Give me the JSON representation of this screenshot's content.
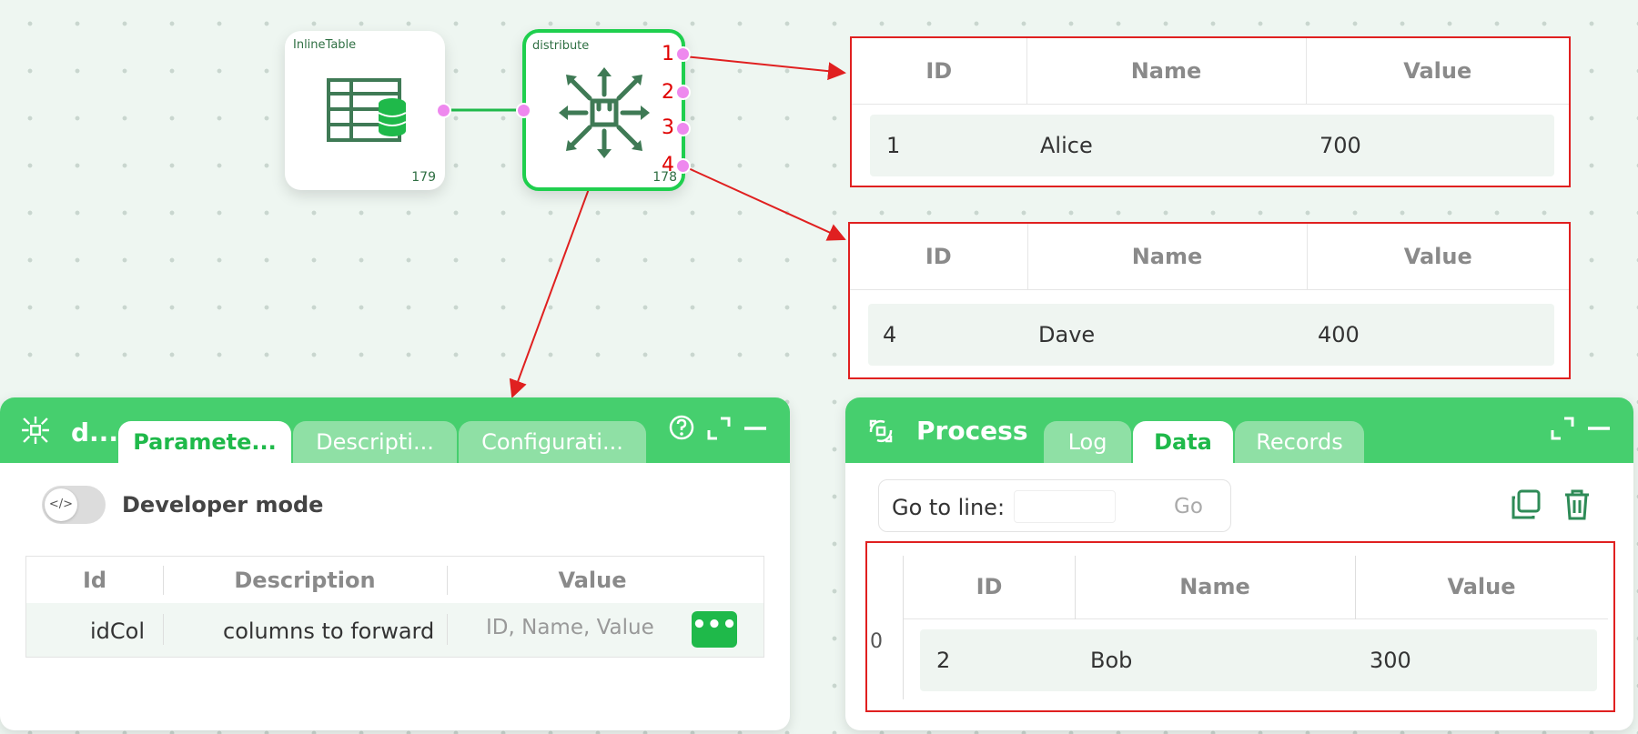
{
  "nodes": {
    "inline_table": {
      "title": "InlineTable",
      "count": "179"
    },
    "distribute": {
      "title": "distribute",
      "count": "178",
      "ports": [
        "1",
        "2",
        "3",
        "4"
      ]
    }
  },
  "output_tables": [
    {
      "columns": [
        "ID",
        "Name",
        "Value"
      ],
      "row": [
        "1",
        "Alice",
        "700"
      ]
    },
    {
      "columns": [
        "ID",
        "Name",
        "Value"
      ],
      "row": [
        "4",
        "Dave",
        "400"
      ]
    }
  ],
  "left_panel": {
    "title": "d...",
    "tabs": [
      "Paramete...",
      "Descripti...",
      "Configurati..."
    ],
    "developer_mode_label": "Developer mode",
    "toggle_glyph": "</>",
    "params": {
      "columns": [
        "Id",
        "Description",
        "Value"
      ],
      "rows": [
        {
          "id": "idCol",
          "description": "columns to forward",
          "value": "ID, Name, Value"
        }
      ]
    },
    "more_label": "•••"
  },
  "right_panel": {
    "title": "Process",
    "tabs": [
      "Log",
      "Data",
      "Records"
    ],
    "goto_label": "Go to line:",
    "goto_value": "",
    "go_button": "Go",
    "table": {
      "index": "0",
      "columns": [
        "ID",
        "Name",
        "Value"
      ],
      "row": [
        "2",
        "Bob",
        "300"
      ]
    }
  },
  "colors": {
    "accent": "#46cf6e",
    "accent_dark": "#1fb94a",
    "node_icon": "#3f7a55",
    "port": "#ee88ee",
    "annotation": "#e02020"
  }
}
